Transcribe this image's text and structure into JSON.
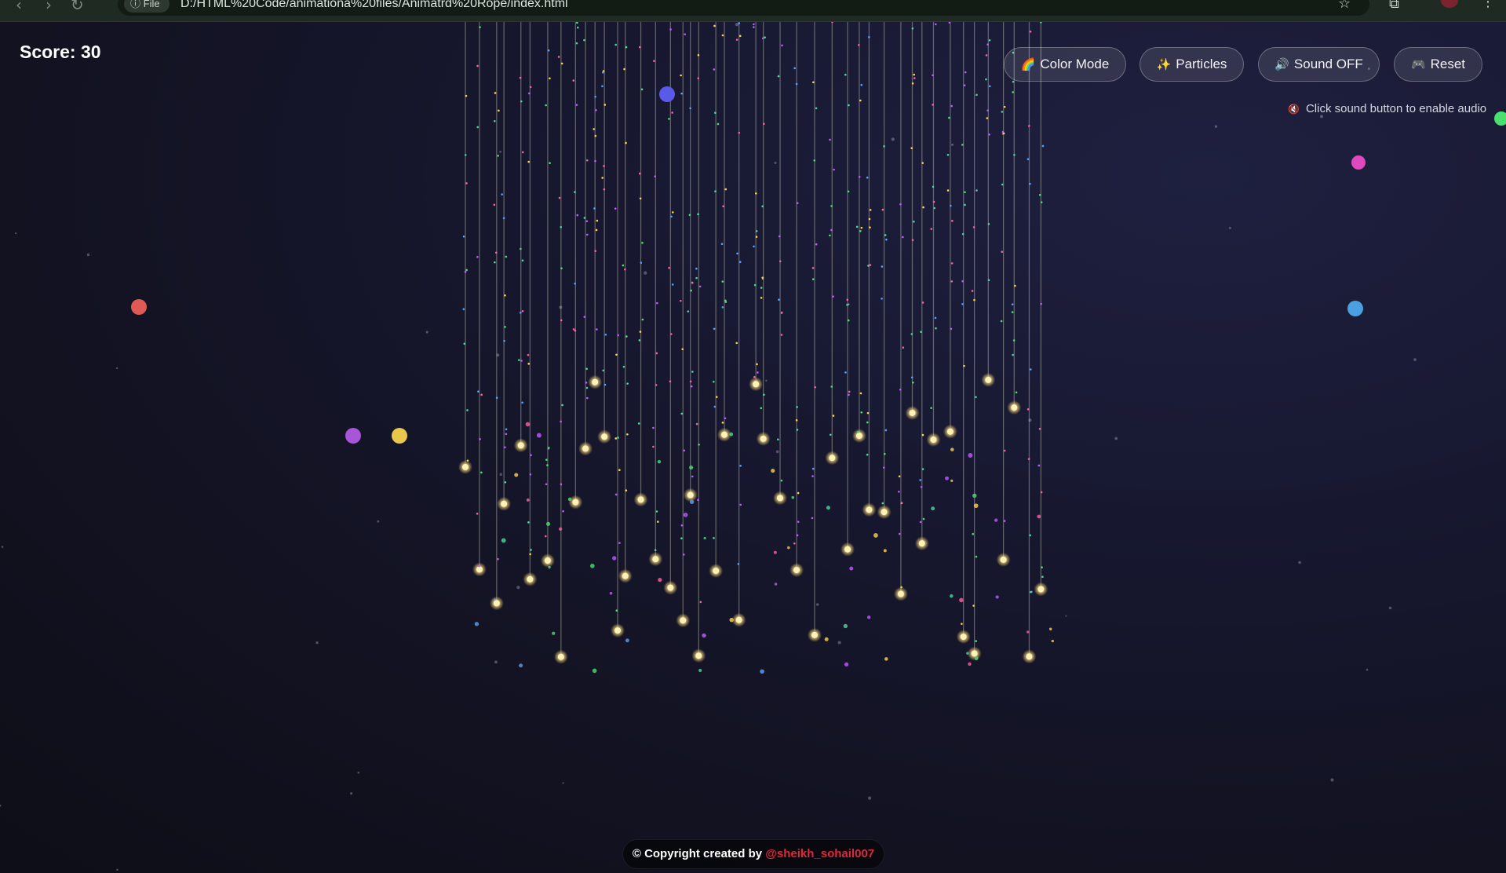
{
  "browser": {
    "url_chip_label": "File",
    "url": "D:/HTML%20Code/animationa%20files/Animatrd%20Rope/index.html",
    "back_icon": "back-arrow-icon",
    "forward_icon": "forward-arrow-icon",
    "reload_icon": "reload-icon",
    "info_icon": "info-icon",
    "bookmark_icon": "star-icon",
    "extensions_icon": "extensions-icon",
    "menu_icon": "kebab-menu-icon"
  },
  "game": {
    "score_label": "Score: 30",
    "score_value": 30,
    "controls": {
      "color_mode": {
        "icon": "rainbow-icon",
        "label": "Color Mode"
      },
      "particles": {
        "icon": "sparkles-icon",
        "label": "Particles"
      },
      "sound": {
        "icon": "speaker-icon",
        "label": "Sound OFF"
      },
      "reset": {
        "icon": "game-controller-icon",
        "label": "Reset"
      }
    },
    "audio_hint": {
      "icon": "muted-speaker-icon",
      "text": "Click sound button to enable audio"
    },
    "floating_balls": [
      {
        "color": "#e05a55"
      },
      {
        "color": "#a855d8"
      },
      {
        "color": "#e8c84a"
      },
      {
        "color": "#5a5ae8"
      },
      {
        "color": "#e048c0"
      },
      {
        "color": "#4aa0e0"
      },
      {
        "color": "#4ae070"
      }
    ],
    "rope_bead_color": "#ffe08a",
    "particle_colors": [
      "#ff5fa2",
      "#4ad8a0",
      "#5aa0ff",
      "#ffd24a",
      "#c05aff",
      "#4ae070"
    ]
  },
  "footer": {
    "prefix": "© Copyright created by ",
    "handle": "@sheikh_sohail007"
  }
}
